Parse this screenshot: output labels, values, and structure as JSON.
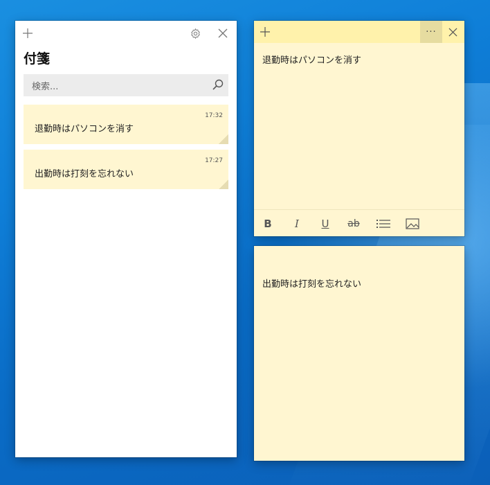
{
  "list_window": {
    "title": "付箋",
    "search_placeholder": "検索...",
    "notes": [
      {
        "time": "17:32",
        "text": "退勤時はパソコンを消す"
      },
      {
        "time": "17:27",
        "text": "出勤時は打刻を忘れない"
      }
    ]
  },
  "sticky_notes": [
    {
      "text": "退勤時はパソコンを消す",
      "more_label": "···"
    },
    {
      "text": "出勤時は打刻を忘れない"
    }
  ],
  "toolbar": {
    "bold": "B",
    "italic": "I",
    "underline": "U",
    "strikethrough": "ab"
  },
  "colors": {
    "note_bg": "#fff6d1",
    "note_titlebar": "#fff2ab",
    "desktop": "#0a6cc6"
  }
}
